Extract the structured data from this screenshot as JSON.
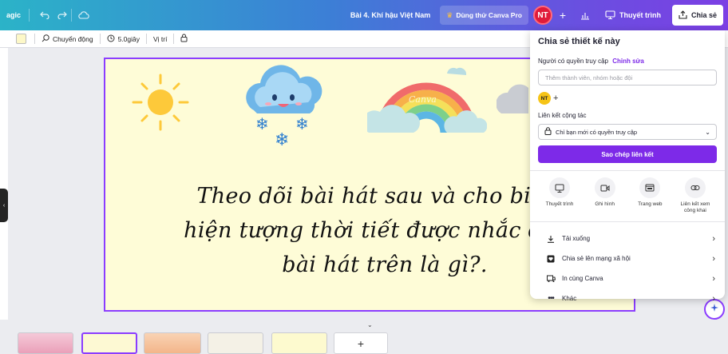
{
  "topbar": {
    "magic_label": "agic",
    "doc_title": "Bài 4. Khí hậu Việt Nam",
    "try_pro_label": "Dùng thử Canva Pro",
    "user_initials": "NT",
    "present_label": "Thuyết trình",
    "share_label": "Chia sẻ",
    "colors": {
      "gradient_start": "#2bb3c8",
      "gradient_end": "#7b3fe4",
      "avatar": "#e01b3a"
    }
  },
  "toolbar2": {
    "animation_label": "Chuyển động",
    "duration_label": "5.0giây",
    "position_label": "Vị trí"
  },
  "slide": {
    "line1": "Theo dõi bài hát sau và cho biết c",
    "line2": "hiện tượng thời tiết được nhắc đến t",
    "line3": "bài hát trên là gì?.",
    "rainbow_text": "Canva",
    "background": "#fefcd7"
  },
  "share_panel": {
    "title": "Chia sẻ thiết kế này",
    "access_label": "Người có quyền truy cập",
    "edit_link": "Chỉnh sửa",
    "add_placeholder": "Thêm thành viên, nhóm hoặc đội",
    "member_initials": "NT",
    "collab_label": "Liên kết cộng tác",
    "access_option": "Chỉ bạn mới có quyền truy cập",
    "copy_button": "Sao chép liên kết",
    "options": [
      {
        "label": "Thuyết trình",
        "icon": "present-icon"
      },
      {
        "label": "Ghi hình",
        "icon": "record-icon"
      },
      {
        "label": "Trang web",
        "icon": "website-icon"
      },
      {
        "label": "Liên kết xem công khai",
        "icon": "public-link-icon"
      }
    ],
    "list": [
      {
        "label": "Tải xuống",
        "icon": "download-icon"
      },
      {
        "label": "Chia sẻ lên mạng xã hội",
        "icon": "social-icon"
      },
      {
        "label": "In cùng Canva",
        "icon": "print-icon"
      },
      {
        "label": "Khác",
        "icon": "more-icon"
      }
    ],
    "accent": "#7d2ae8"
  },
  "pages": {
    "add_label": "+"
  }
}
